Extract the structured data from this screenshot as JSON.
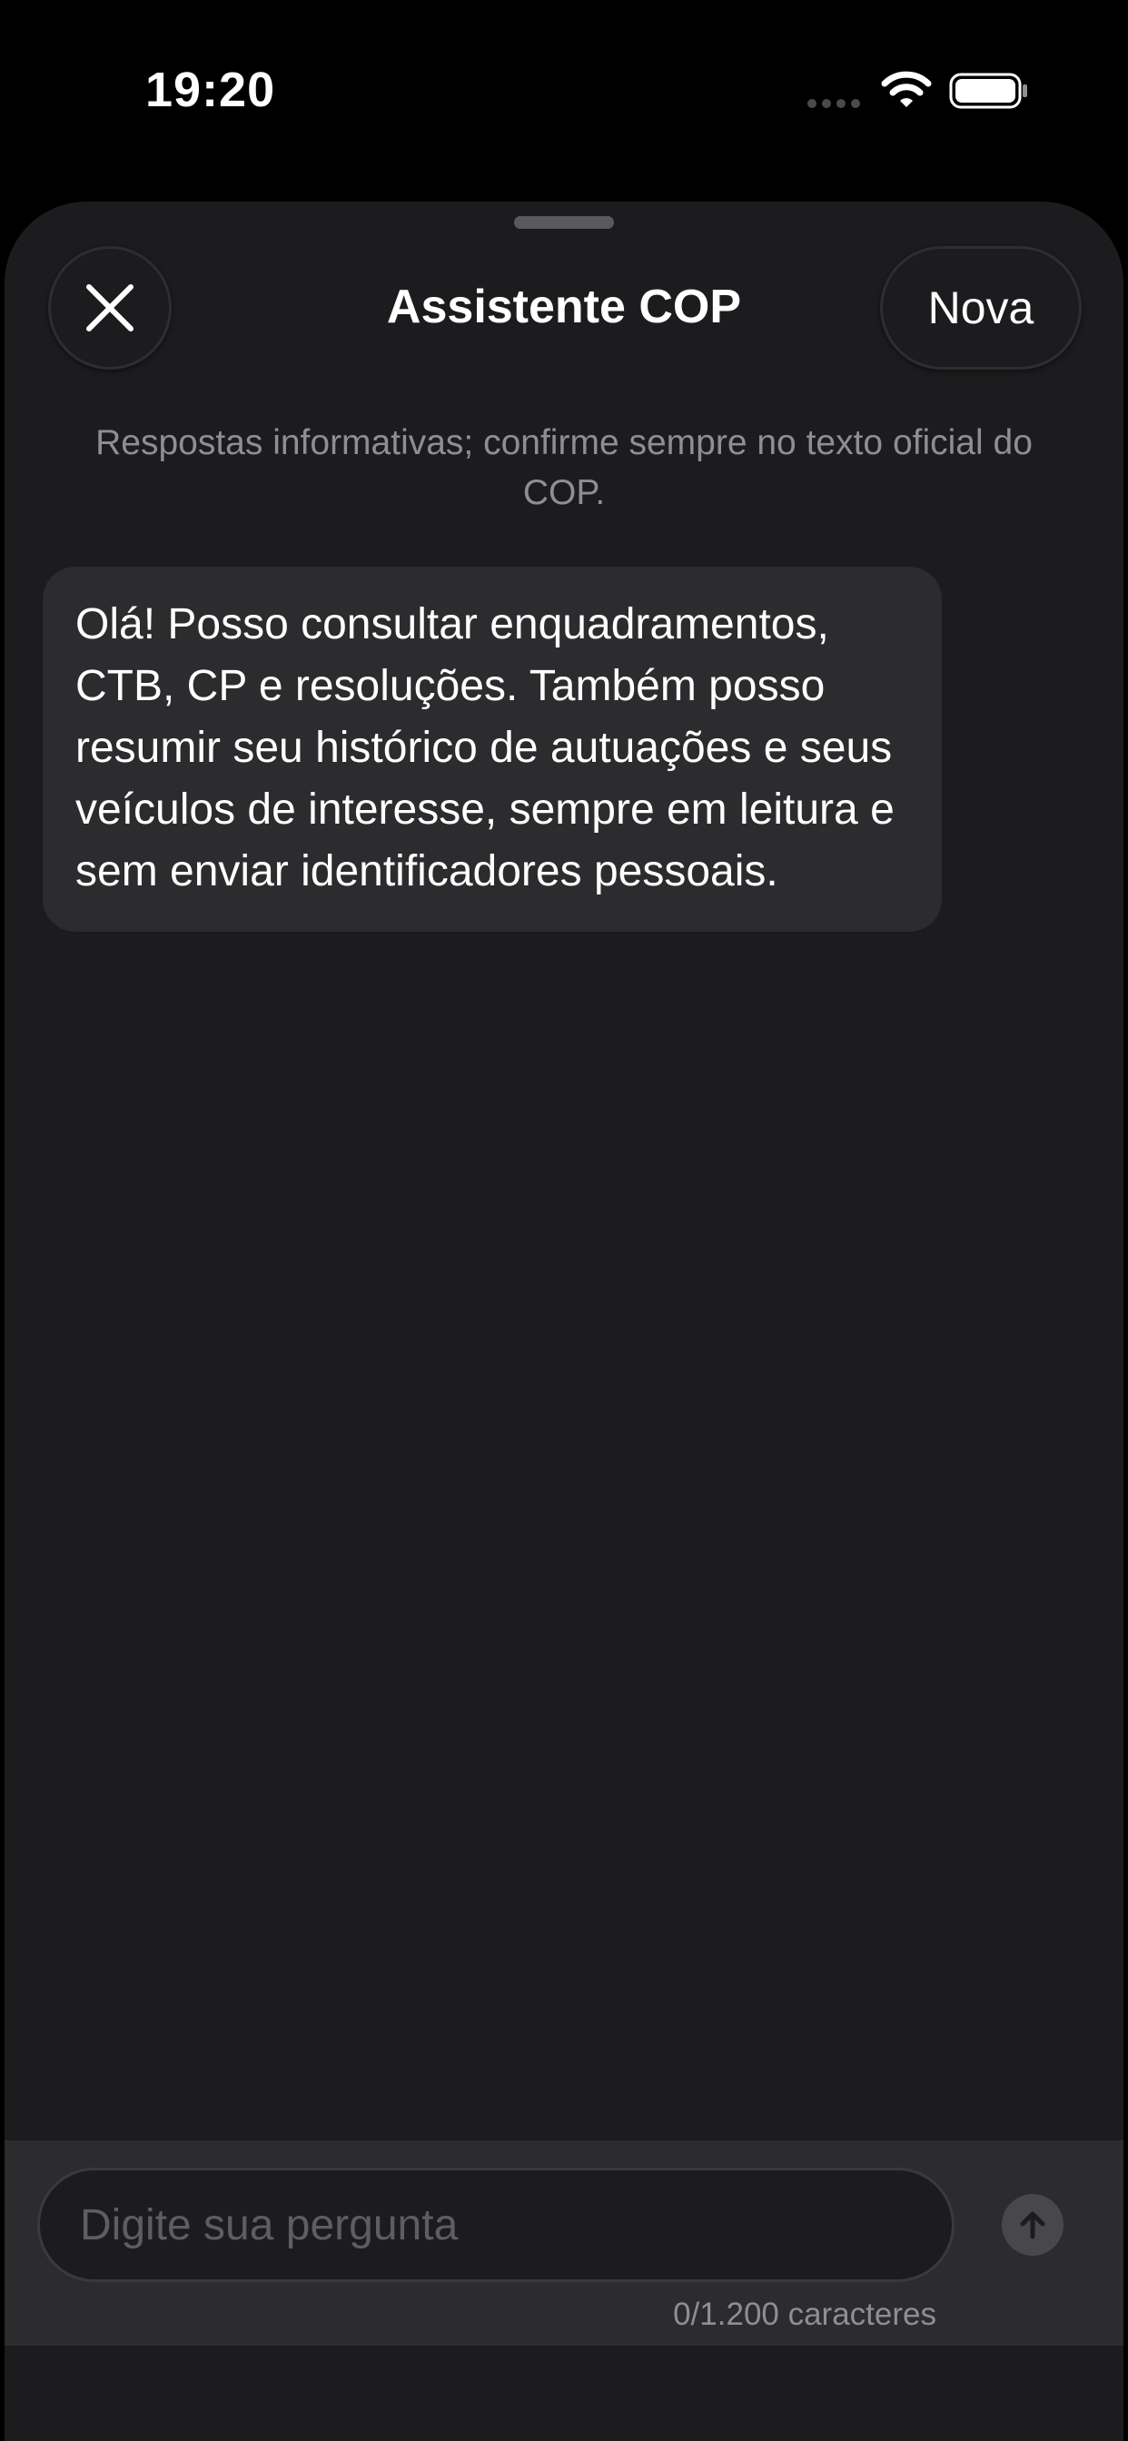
{
  "status_bar": {
    "time": "19:20"
  },
  "sheet": {
    "title": "Assistente COP",
    "close_icon": "close-icon",
    "new_button_label": "Nova",
    "disclaimer": "Respostas informativas; confirme sempre no texto oficial do COP."
  },
  "messages": [
    {
      "role": "assistant",
      "text": "Olá! Posso consultar enquadramentos, CTB, CP e resoluções. Também posso resumir seu histórico de autuações e seus veículos de interesse, sempre em leitura e sem enviar identificadores pessoais."
    }
  ],
  "composer": {
    "placeholder": "Digite sua pergunta",
    "value": "",
    "char_counter": "0/1.200 caracteres",
    "send_icon": "arrow-up-icon"
  },
  "colors": {
    "background": "#000000",
    "sheet": "#1c1c1e",
    "bubble": "#2c2c2e",
    "secondary_text": "#8e8e93",
    "placeholder": "#5d5d62",
    "send_disabled": "#48484a"
  }
}
